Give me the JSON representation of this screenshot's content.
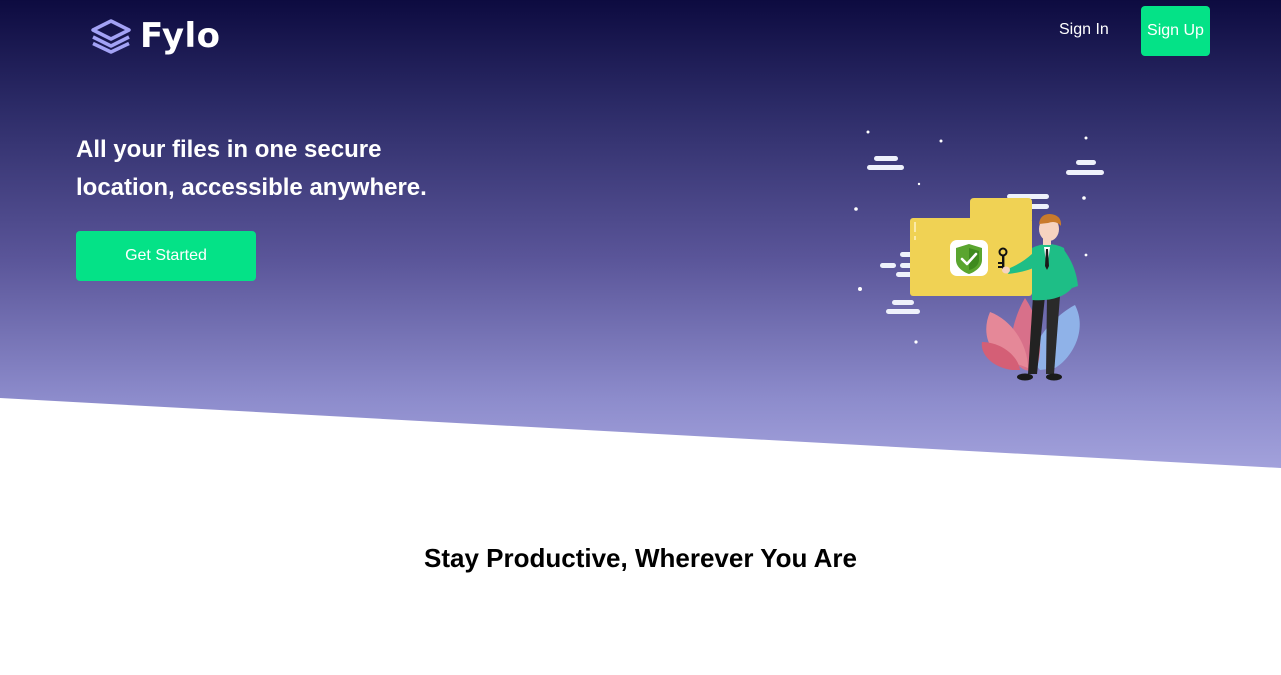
{
  "brand": {
    "name": "Fylo",
    "logo_icon": "layers-icon",
    "logo_color": "#a3a2f5"
  },
  "nav": {
    "sign_in_label": "Sign In",
    "sign_up_label": "Sign Up"
  },
  "hero": {
    "headline": "All your files in one secure location, accessible anywhere.",
    "cta_label": "Get Started",
    "illustration": "person-unlocking-folder-illustration"
  },
  "features": {
    "title": "Stay Productive, Wherever You Are"
  },
  "colors": {
    "accent": "#04e287",
    "hero_top": "#0d0b40",
    "hero_bottom": "#a3a2dc",
    "folder": "#f0d254",
    "shield": "#5aa52f"
  }
}
